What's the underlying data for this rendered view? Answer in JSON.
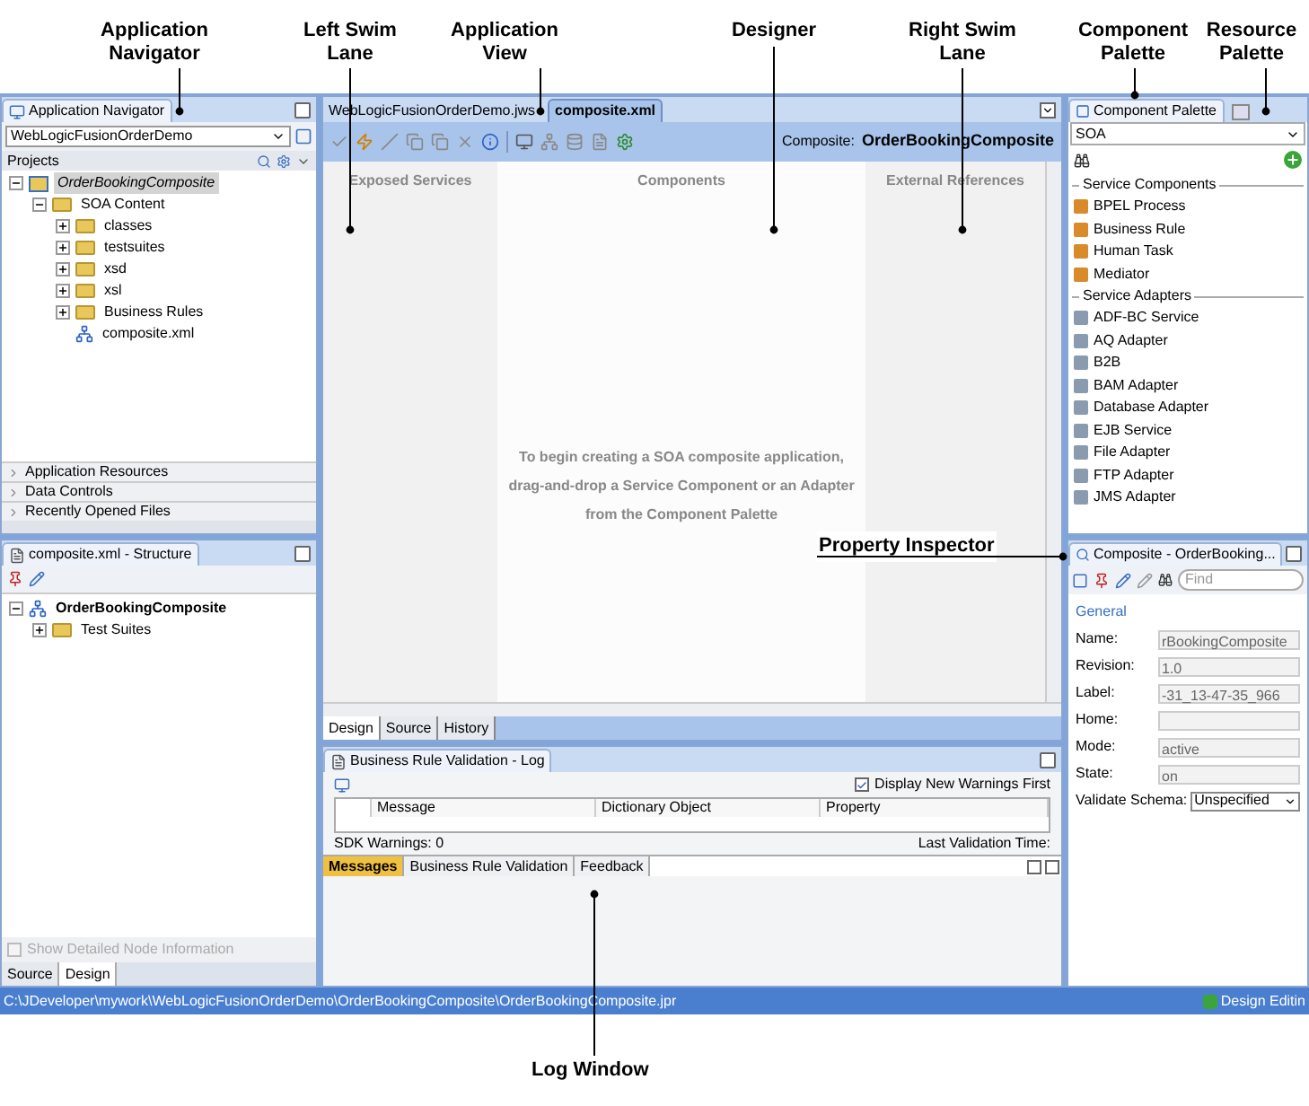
{
  "annotations": [
    {
      "label": "Application Navigator"
    },
    {
      "label": "Left Swim Lane"
    },
    {
      "label": "Application View"
    },
    {
      "label": "Designer"
    },
    {
      "label": "Right Swim Lane"
    },
    {
      "label": "Component Palette"
    },
    {
      "label": "Resource Palette"
    },
    {
      "label": "Property Inspector"
    },
    {
      "label": "Log Window"
    }
  ],
  "navigator": {
    "tab": "Application Navigator",
    "application": "WebLogicFusionOrderDemo",
    "projects_label": "Projects",
    "tree": [
      {
        "label": "OrderBookingComposite",
        "kind": "project",
        "selected": true,
        "expanded": true,
        "children": [
          {
            "label": "SOA Content",
            "kind": "folder",
            "selected": false,
            "expanded": true,
            "children": [
              {
                "label": "classes",
                "kind": "folder",
                "selected": false,
                "expanded": false
              },
              {
                "label": "testsuites",
                "kind": "folder",
                "selected": false,
                "expanded": false
              },
              {
                "label": "xsd",
                "kind": "folder",
                "selected": false,
                "expanded": false
              },
              {
                "label": "xsl",
                "kind": "folder",
                "selected": false,
                "expanded": false
              },
              {
                "label": "Business Rules",
                "kind": "folder",
                "selected": false,
                "expanded": false
              },
              {
                "label": "composite.xml",
                "kind": "file",
                "selected": false
              }
            ]
          }
        ]
      }
    ],
    "accordions": [
      {
        "label": "Application Resources",
        "expanded": false
      },
      {
        "label": "Data Controls",
        "expanded": false
      },
      {
        "label": "Recently Opened Files",
        "expanded": false
      }
    ]
  },
  "structure": {
    "tab": "composite.xml - Structure",
    "tree": [
      {
        "label": "OrderBookingComposite",
        "kind": "composite",
        "selected": false,
        "expanded": true,
        "children": [
          {
            "label": "Test Suites",
            "kind": "folder",
            "selected": false,
            "expanded": false
          }
        ]
      }
    ],
    "detail_checkbox": {
      "label": "Show Detailed Node Information",
      "checked": false,
      "disabled": true
    },
    "tabs": [
      {
        "label": "Source",
        "selected": false
      },
      {
        "label": "Design",
        "selected": true
      }
    ]
  },
  "editor": {
    "tabs": [
      {
        "label": "WebLogicFusionOrderDemo.jws",
        "selected": false
      },
      {
        "label": "composite.xml",
        "selected": true
      }
    ],
    "composite_label": "Composite:",
    "composite_name": "OrderBookingComposite",
    "lanes": [
      "Exposed Services",
      "Components",
      "External References"
    ],
    "hint": [
      "To begin creating a SOA composite application,",
      "drag-and-drop a Service Component or an Adapter",
      "from the Component Palette"
    ],
    "tabs_bottom": [
      {
        "label": "Design",
        "selected": true
      },
      {
        "label": "Source",
        "selected": false
      },
      {
        "label": "History",
        "selected": false
      }
    ]
  },
  "log": {
    "tab": "Business Rule Validation - Log",
    "warnings_checkbox": {
      "label": "Display New Warnings First",
      "checked": true
    },
    "columns": [
      "Message",
      "Dictionary Object",
      "Property"
    ],
    "sdk_warnings": "SDK Warnings: 0",
    "last_validation": "Last Validation Time:",
    "tabs": [
      {
        "label": "Messages",
        "selected": true
      },
      {
        "label": "Business Rule Validation",
        "selected": false
      },
      {
        "label": "Feedback",
        "selected": false
      }
    ]
  },
  "palette": {
    "tab": "Component Palette",
    "category": "SOA",
    "sections": [
      {
        "title": "Service Components",
        "items": [
          "BPEL Process",
          "Business Rule",
          "Human Task",
          "Mediator"
        ]
      },
      {
        "title": "Service Adapters",
        "items": [
          "ADF-BC Service",
          "AQ Adapter",
          "B2B",
          "BAM Adapter",
          "Database Adapter",
          "EJB Service",
          "File Adapter",
          "FTP Adapter",
          "JMS Adapter"
        ]
      }
    ]
  },
  "inspector": {
    "tab": "Composite - OrderBooking...",
    "find_placeholder": "Find",
    "section": "General",
    "fields": [
      {
        "label": "Name:",
        "kind": "text",
        "value": "rBookingComposite"
      },
      {
        "label": "Revision:",
        "kind": "text",
        "value": "1.0"
      },
      {
        "label": "Label:",
        "kind": "text",
        "value": "-31_13-47-35_966"
      },
      {
        "label": "Home:",
        "kind": "text"
      },
      {
        "label": "Mode:",
        "kind": "text",
        "value": "active"
      },
      {
        "label": "State:",
        "kind": "text",
        "value": "on"
      },
      {
        "label": "Validate Schema:",
        "kind": "select",
        "value": "Unspecified"
      }
    ]
  },
  "status_bar": {
    "path": "C:\\JDeveloper\\mywork\\WebLogicFusionOrderDemo\\OrderBookingComposite\\OrderBookingComposite.jpr",
    "mode": "Design Editin"
  }
}
